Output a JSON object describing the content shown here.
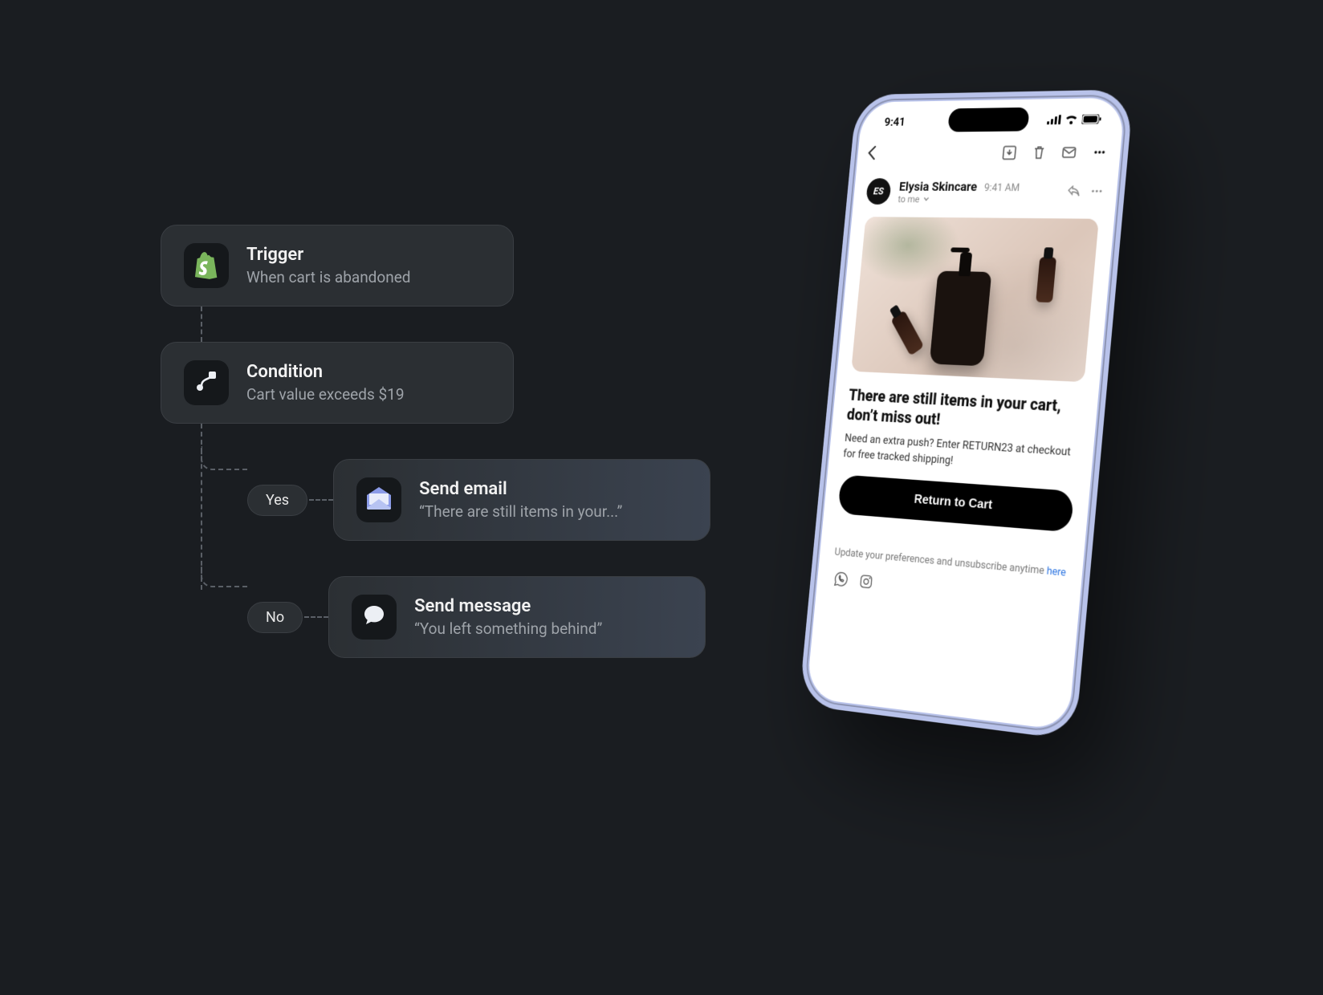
{
  "flow": {
    "trigger": {
      "title": "Trigger",
      "subtitle": "When cart is abandoned"
    },
    "condition": {
      "title": "Condition",
      "subtitle": "Cart value exceeds $19"
    },
    "branches": {
      "yes": {
        "pill": "Yes",
        "action_title": "Send email",
        "action_sub": "“There are still items in your...”"
      },
      "no": {
        "pill": "No",
        "action_title": "Send message",
        "action_sub": "“You left something behind”"
      }
    }
  },
  "phone": {
    "status_time": "9:41",
    "sender": {
      "avatar_initials": "ES",
      "name": "Elysia Skincare",
      "time": "9:41 AM",
      "to": "to me"
    },
    "email": {
      "headline": "There are still items in your cart, don’t miss out!",
      "body": "Need an extra push? Enter RETURN23 at checkout for free tracked shipping!",
      "cta": "Return to Cart",
      "footer_pre": "Update your preferences and unsubscribe anytime ",
      "footer_link": "here"
    }
  }
}
